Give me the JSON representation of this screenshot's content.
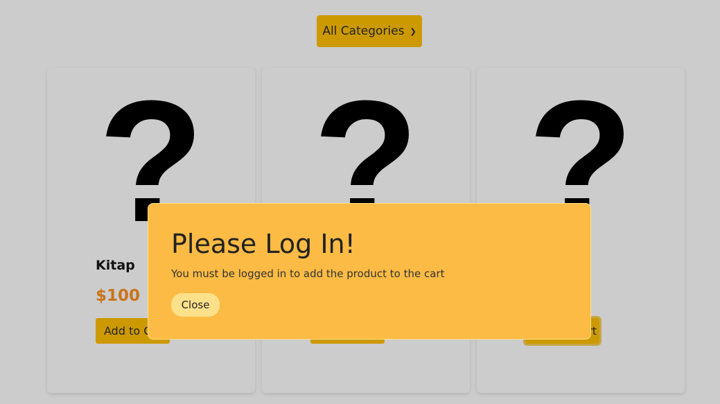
{
  "filter": {
    "selected": "All Categories",
    "icon": "chevron-down-icon"
  },
  "products": [
    {
      "name": "Kitap",
      "price": "$100",
      "add_label": "Add to Cart",
      "image_glyph": "?"
    },
    {
      "name": "",
      "price": "",
      "add_label": "Add to Cart",
      "image_glyph": "?"
    },
    {
      "name": "",
      "price": "",
      "add_label": "Add to Cart",
      "image_glyph": "?"
    }
  ],
  "modal": {
    "title": "Please Log In!",
    "message": "You must be logged in to add the product to the cart",
    "close_label": "Close"
  },
  "colors": {
    "background": "#cccccc",
    "accent": "#cc9900",
    "price": "#c8741b",
    "modal_bg": "#fbbb44",
    "modal_button": "#fde08a"
  }
}
